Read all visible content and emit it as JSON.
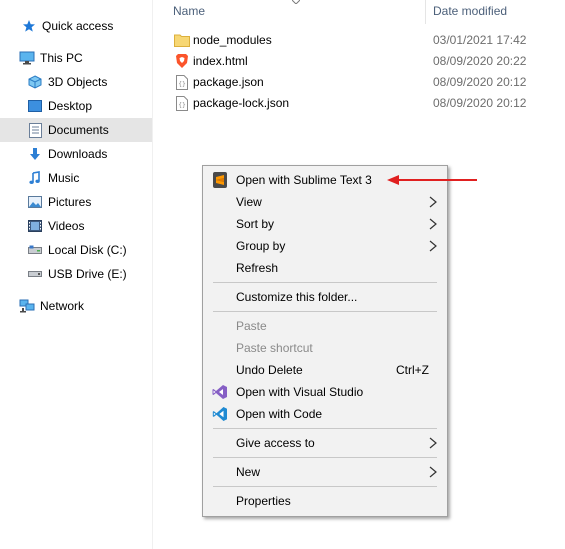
{
  "sidebar": {
    "items": [
      {
        "label": "Quick access",
        "icon": "star-icon"
      },
      {
        "label": "This PC",
        "icon": "monitor-icon"
      },
      {
        "label": "3D Objects",
        "icon": "cube-icon"
      },
      {
        "label": "Desktop",
        "icon": "desktop-icon"
      },
      {
        "label": "Documents",
        "icon": "document-icon"
      },
      {
        "label": "Downloads",
        "icon": "download-icon"
      },
      {
        "label": "Music",
        "icon": "music-icon"
      },
      {
        "label": "Pictures",
        "icon": "picture-icon"
      },
      {
        "label": "Videos",
        "icon": "video-icon"
      },
      {
        "label": "Local Disk (C:)",
        "icon": "disk-icon"
      },
      {
        "label": "USB Drive (E:)",
        "icon": "usb-icon"
      },
      {
        "label": "Network",
        "icon": "network-icon"
      }
    ],
    "selected": "Documents"
  },
  "file_list": {
    "columns": {
      "name": "Name",
      "date": "Date modified"
    },
    "rows": [
      {
        "name": "node_modules",
        "date": "03/01/2021 17:42",
        "icon": "folder-icon"
      },
      {
        "name": "index.html",
        "date": "08/09/2020 20:22",
        "icon": "brave-html-icon"
      },
      {
        "name": "package.json",
        "date": "08/09/2020 20:12",
        "icon": "json-file-icon"
      },
      {
        "name": "package-lock.json",
        "date": "08/09/2020 20:12",
        "icon": "json-file-icon"
      }
    ]
  },
  "context_menu": {
    "open_sublime": "Open with Sublime Text 3",
    "view": "View",
    "sort_by": "Sort by",
    "group_by": "Group by",
    "refresh": "Refresh",
    "customize": "Customize this folder...",
    "paste": "Paste",
    "paste_shortcut": "Paste shortcut",
    "undo_delete": "Undo Delete",
    "undo_shortcut": "Ctrl+Z",
    "open_visual_studio": "Open with Visual Studio",
    "open_code": "Open with Code",
    "give_access": "Give access to",
    "new": "New",
    "properties": "Properties"
  },
  "colors": {
    "annotation_arrow": "#e02020",
    "selected_bg": "#e5e5e5",
    "menu_bg": "#f2f2f2"
  }
}
